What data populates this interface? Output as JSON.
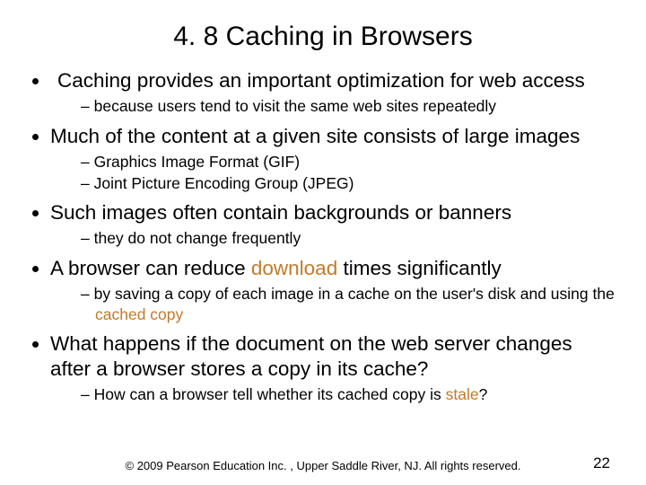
{
  "title": "4. 8  Caching in Browsers",
  "b1": "Caching provides an important optimization for web access",
  "b1s1": "because users tend to visit the same web sites repeatedly",
  "b2": "Much of the content at a given site consists of large images",
  "b2s1": "Graphics Image Format (GIF)",
  "b2s2": "Joint Picture Encoding Group (JPEG)",
  "b3": "Such images often contain backgrounds or banners",
  "b3s1": "they do not change frequently",
  "b4_pre": "A browser can reduce ",
  "b4_dl": "download",
  "b4_post": " times significantly",
  "b4s1": "by saving a copy of each image in a cache on the user's disk and using the ",
  "b4s1_cached": "cached copy",
  "b5": "What happens if the document on the web server changes after a browser stores a copy in its cache?",
  "b5s1_pre": "How can a browser tell whether its cached copy is ",
  "b5s1_stale": "stale",
  "b5s1_post": "?",
  "footer": "© 2009 Pearson Education Inc. , Upper Saddle River, NJ. All rights reserved.",
  "page": "22"
}
